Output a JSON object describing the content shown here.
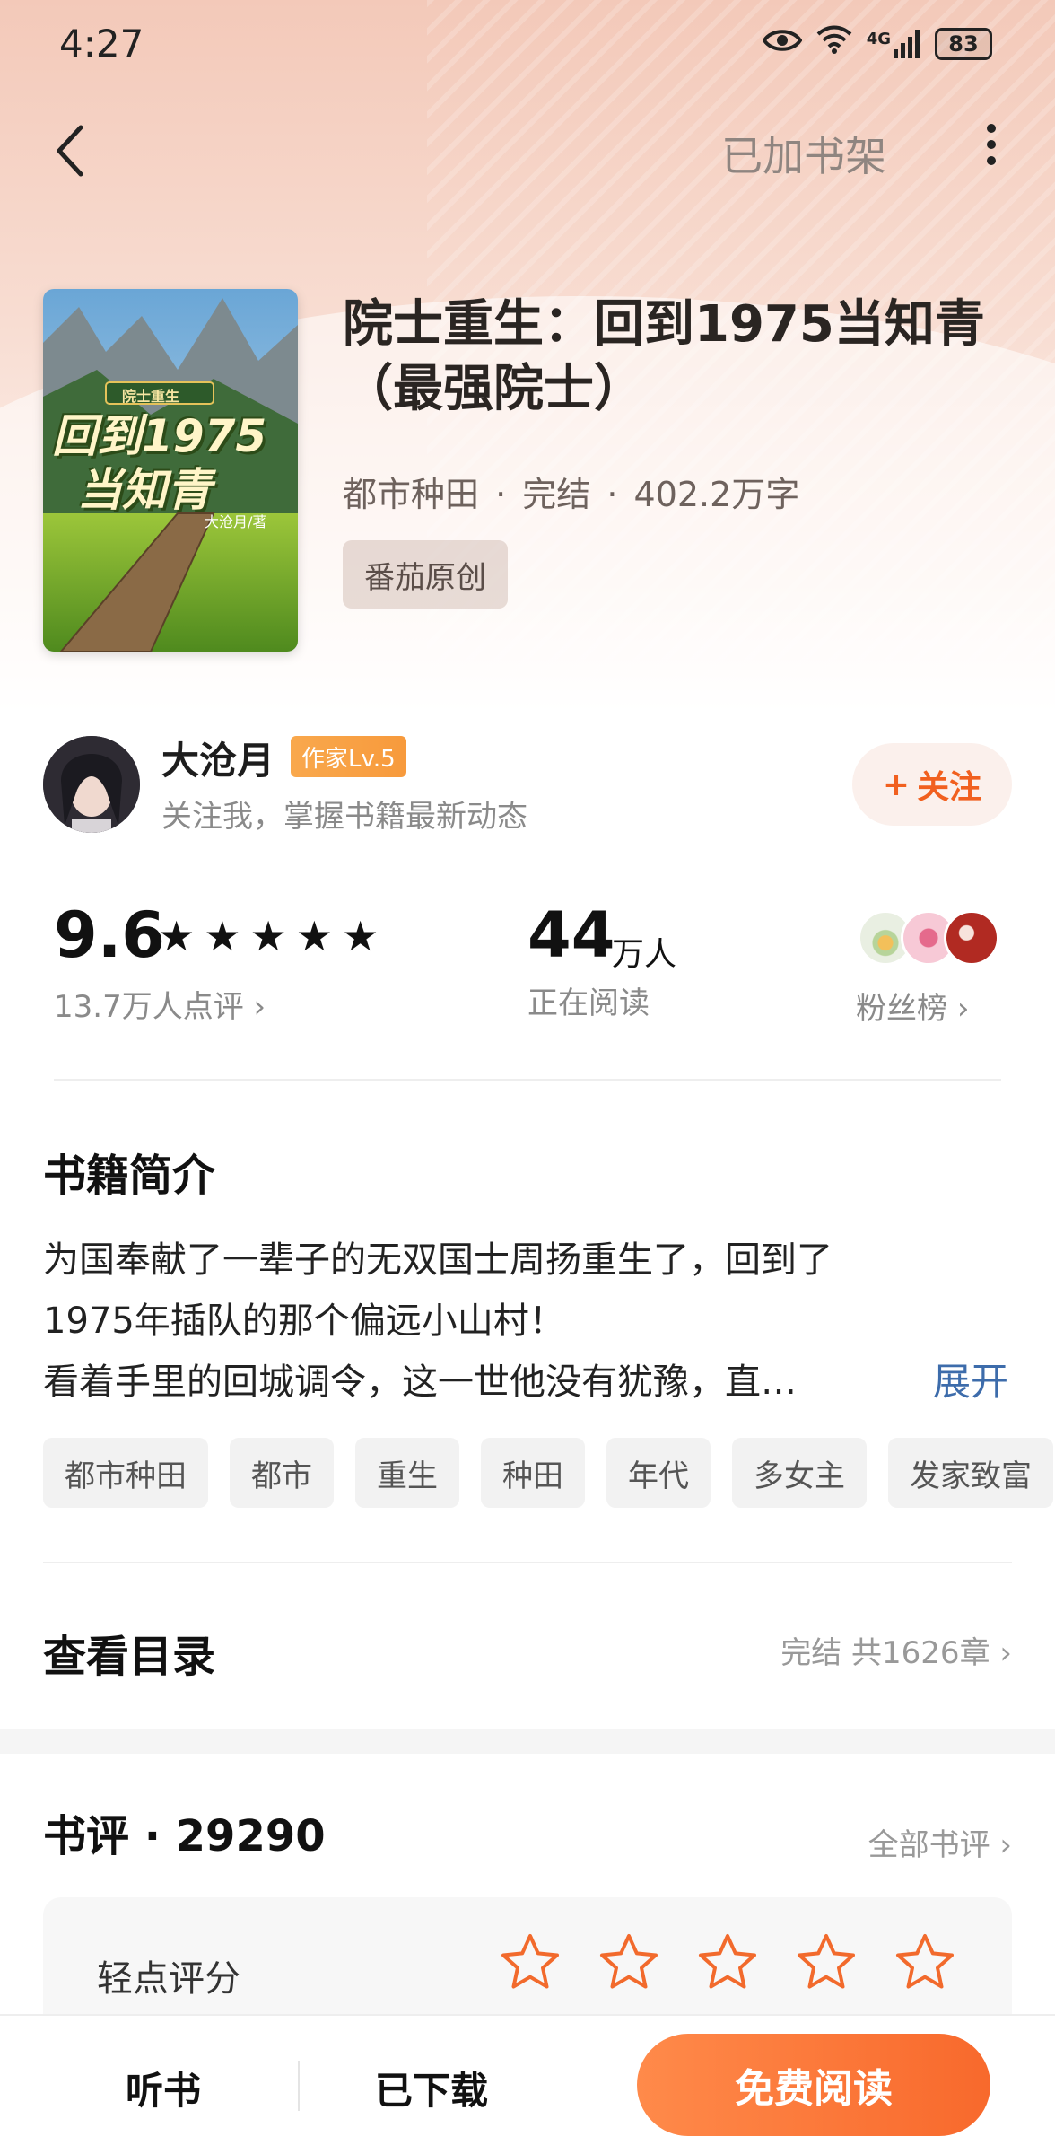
{
  "status_bar": {
    "time": "4:27",
    "network": "4G",
    "battery": "83"
  },
  "nav": {
    "shelf_label": "已加书架"
  },
  "book": {
    "title": "院士重生：回到1975当知青（最强院士）",
    "category": "都市种田",
    "state": "完结",
    "word_count": "402.2万字",
    "tag": "番茄原创",
    "cover": {
      "line1": "院士重生",
      "line2": "回到1975",
      "line3": "当知青",
      "author": "大沧月/著"
    }
  },
  "author": {
    "name": "大沧月",
    "level": "作家Lv.5",
    "subtitle": "关注我，掌握书籍最新动态",
    "follow_label": "关注"
  },
  "stats": {
    "score": "9.6",
    "reviews": "13.7万人点评",
    "readers": "44",
    "readers_unit": "万人",
    "readers_label": "正在阅读",
    "fans_label": "粉丝榜"
  },
  "intro": {
    "title": "书籍简介",
    "line1": "为国奉献了一辈子的无双国士周扬重生了，回到了",
    "line2": "1975年插队的那个偏远小山村！",
    "line3": "看着手里的回城调令，这一世他没有犹豫，直…",
    "expand_label": "展开"
  },
  "tags": [
    "都市种田",
    "都市",
    "重生",
    "种田",
    "年代",
    "多女主",
    "发家致富"
  ],
  "toc": {
    "title": "查看目录",
    "summary": "完结 共1626章"
  },
  "reviews": {
    "title": "书评 · 29290",
    "all_label": "全部书评",
    "rate_label": "轻点评分"
  },
  "bottom_bar": {
    "listen": "听书",
    "downloaded": "已下载",
    "read": "免费阅读"
  },
  "colors": {
    "accent": "#f8692c",
    "link": "#3d6cab",
    "hero": "#f3c9b9"
  }
}
